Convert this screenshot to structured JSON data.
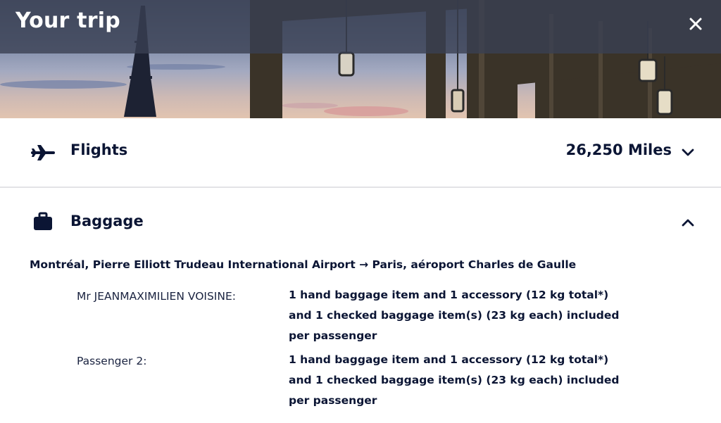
{
  "header": {
    "title": "Your trip",
    "close_icon": "close-icon"
  },
  "flights": {
    "label": "Flights",
    "amount": "26,250 Miles",
    "icon": "airplane-icon",
    "chevron": "chevron-down-icon"
  },
  "baggage": {
    "label": "Baggage",
    "icon": "suitcase-icon",
    "chevron": "chevron-up-icon",
    "route": "Montréal, Pierre Elliott Trudeau International Airport → Paris, aéroport Charles de Gaulle",
    "passengers": [
      {
        "name": "Mr JEANMAXIMILIEN VOISINE:",
        "allowance_lines": [
          "1 hand baggage item and 1 accessory (12 kg total*)",
          "and 1 checked baggage item(s) (23 kg each) included",
          "per passenger"
        ]
      },
      {
        "name": "Passenger 2:",
        "allowance_lines": [
          "1 hand baggage item and 1 accessory (12 kg total*)",
          "and 1 checked baggage item(s) (23 kg each) included",
          "per passenger"
        ]
      }
    ]
  }
}
